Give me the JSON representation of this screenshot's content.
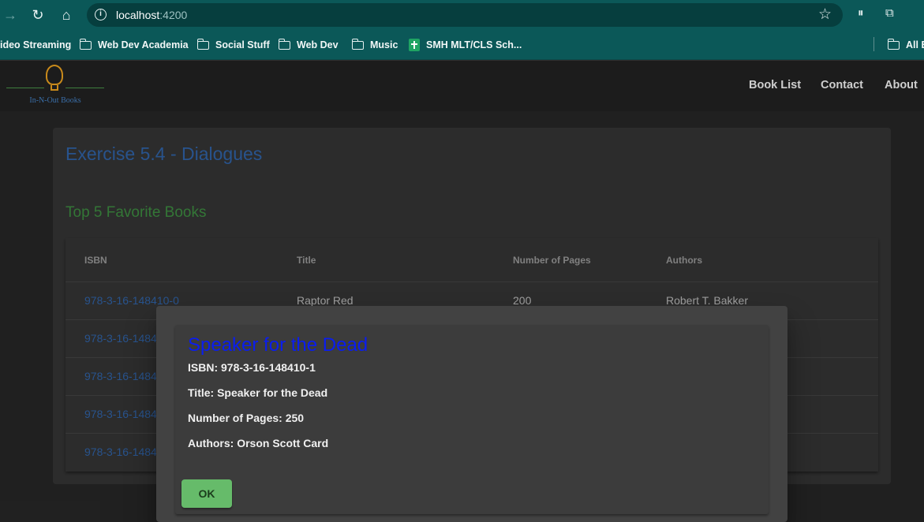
{
  "browser": {
    "url_host": "localhost",
    "url_port": ":4200",
    "bookmarks": [
      {
        "label": "ideo Streaming",
        "icon": "none"
      },
      {
        "label": "Web Dev Academia",
        "icon": "folder-icon"
      },
      {
        "label": "Social Stuff",
        "icon": "folder-icon"
      },
      {
        "label": "Web Dev",
        "icon": "folder-icon"
      },
      {
        "label": "Music",
        "icon": "folder-icon"
      },
      {
        "label": "SMH MLT/CLS Sch...",
        "icon": "sheets-icon"
      },
      {
        "label": "All B",
        "icon": "folder-icon"
      }
    ]
  },
  "app": {
    "logo_text": "In-N-Out Books",
    "nav": [
      "Book List",
      "Contact",
      "About"
    ]
  },
  "page": {
    "title": "Exercise 5.4 - Dialogues",
    "subtitle": "Top 5 Favorite Books",
    "table": {
      "headers": [
        "ISBN",
        "Title",
        "Number of Pages",
        "Authors"
      ],
      "rows": [
        [
          "978-3-16-148410-0",
          "Raptor Red",
          "200",
          "Robert T. Bakker"
        ],
        [
          "978-3-16-1484",
          "",
          "",
          ""
        ],
        [
          "978-3-16-1484",
          "",
          "",
          ""
        ],
        [
          "978-3-16-1484",
          "",
          "",
          ""
        ],
        [
          "978-3-16-1484",
          "",
          "",
          ""
        ]
      ]
    }
  },
  "dialog": {
    "title": "Speaker for the Dead",
    "isbn_line": "ISBN: 978-3-16-148410-1",
    "title_line": "Title: Speaker for the Dead",
    "pages_line": "Number of Pages: 250",
    "authors_line": "Authors: Orson Scott Card",
    "ok_label": "OK"
  },
  "colors": {
    "browser_frame": "#0b5858",
    "accent_blue": "#3b7bd0",
    "accent_green": "#4caf50",
    "dialog_title": "#0a1df0",
    "ok_button": "#66bb6a"
  }
}
